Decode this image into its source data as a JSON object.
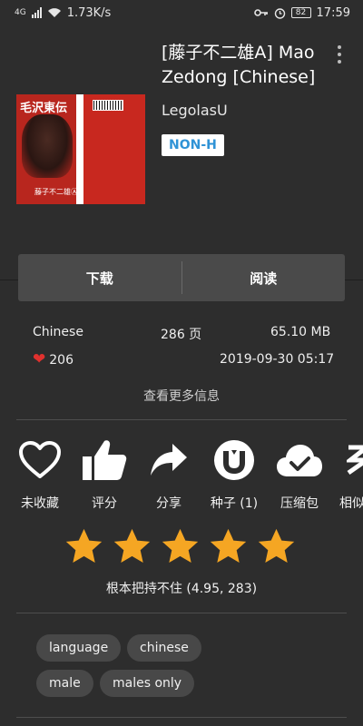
{
  "status_bar": {
    "network": "4G",
    "speed": "1.73K/s",
    "battery": "82",
    "time": "17:59"
  },
  "gallery": {
    "title": "[藤子不二雄A] Mao Zedong [Chinese]",
    "uploader": "LegolasU",
    "category": "NON-H",
    "cover_title": "毛沢東伝",
    "cover_author": "藤子不二雄Ⓐ"
  },
  "actions": {
    "download": "下载",
    "read": "阅读"
  },
  "meta": {
    "language": "Chinese",
    "pages": "286 页",
    "size": "65.10 MB",
    "favorites": "206",
    "posted": "2019-09-30 05:17",
    "more_info": "查看更多信息"
  },
  "icon_actions": [
    {
      "label": "未收藏",
      "icon": "heart-outline-icon"
    },
    {
      "label": "评分",
      "icon": "thumbs-up-icon"
    },
    {
      "label": "分享",
      "icon": "share-arrow-icon"
    },
    {
      "label": "种子 (1)",
      "icon": "torrent-icon"
    },
    {
      "label": "压缩包",
      "icon": "cloud-check-icon"
    },
    {
      "label": "相似",
      "icon": "similar-icon"
    }
  ],
  "rating": {
    "stars": 5,
    "text": "根本把持不住 (4.95, 283)",
    "star_color": "#f5a623"
  },
  "tags": [
    "language",
    "chinese",
    "male",
    "males only"
  ],
  "colors": {
    "background": "#2d2d2d",
    "button_bg": "#4a4a4a",
    "category_text": "#2f93d6",
    "heart": "#e0312e"
  }
}
